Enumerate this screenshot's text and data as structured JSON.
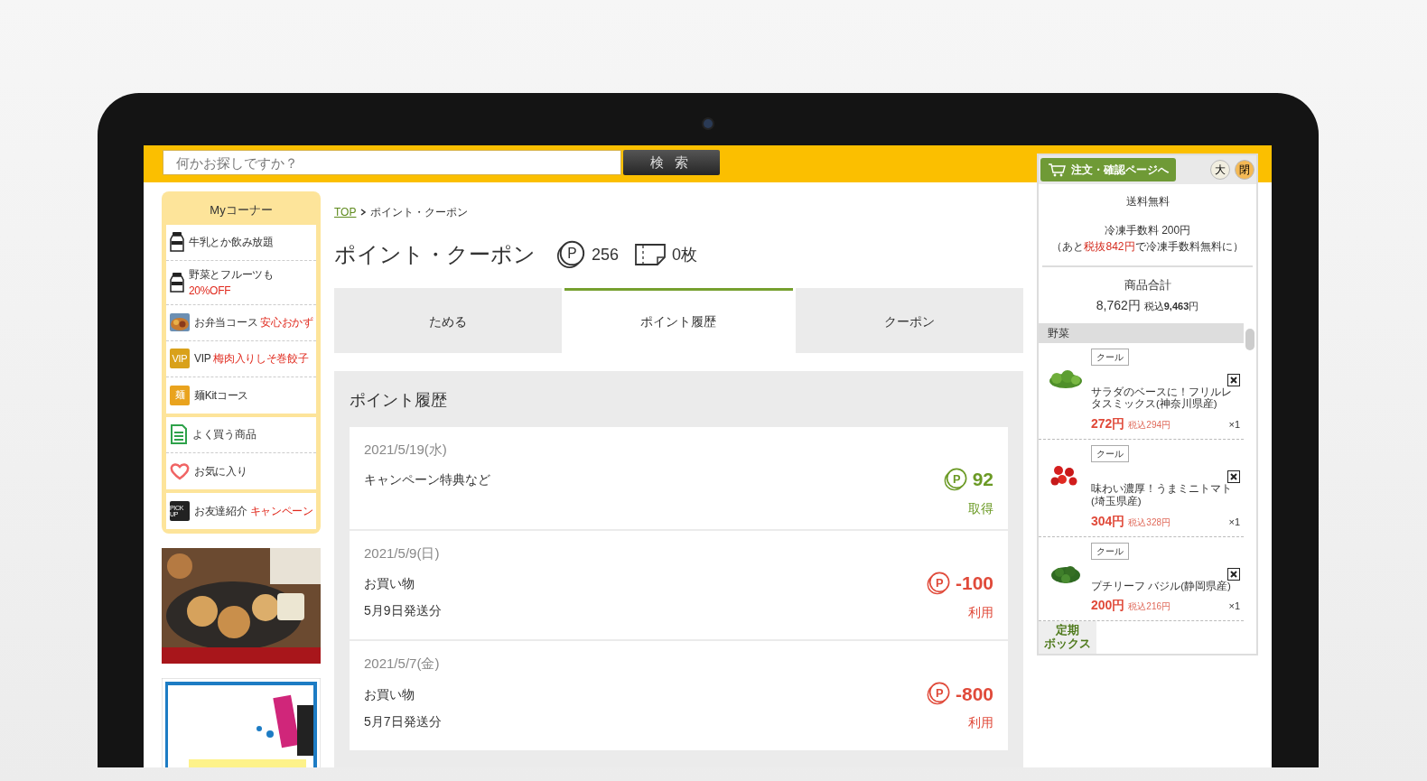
{
  "search": {
    "placeholder": "何かお探しですか？",
    "button": "検索"
  },
  "sidebar": {
    "title": "Myコーナー",
    "groups": [
      [
        {
          "kind": "milk",
          "label": "牛乳とか飲み放題"
        },
        {
          "kind": "milk",
          "label": "野菜とフルーツも",
          "note": "20%OFF",
          "note_below": true
        },
        {
          "kind": "bento",
          "label": "お弁当コース",
          "note": "安心おかず"
        },
        {
          "kind": "vip",
          "badge": "VIP",
          "label": "VIP",
          "note": "梅肉入りしそ巻餃子"
        },
        {
          "kind": "noodle",
          "badge": "麺",
          "label": "麺Kitコース"
        }
      ],
      [
        {
          "kind": "list",
          "label": "よく買う商品"
        },
        {
          "kind": "heart",
          "label": "お気に入り"
        }
      ],
      [
        {
          "kind": "pickup",
          "badge": "PICK UP",
          "label": "お友達紹介",
          "note": "キャンペーン"
        }
      ]
    ]
  },
  "breadcrumb": [
    {
      "label": "TOP",
      "link": true
    },
    {
      "label": "ポイント・クーポン",
      "link": false
    }
  ],
  "title": "ポイント・クーポン",
  "points": {
    "icon_letter": "P",
    "value": "256"
  },
  "coupons": {
    "value": "0枚"
  },
  "tabs": [
    {
      "label": "ためる",
      "selected": false
    },
    {
      "label": "ポイント履歴",
      "selected": true
    },
    {
      "label": "クーポン",
      "selected": false
    }
  ],
  "history": {
    "title": "ポイント履歴",
    "entries": [
      {
        "date": "2021/5/19(水)",
        "lines": [
          "キャンペーン特典など"
        ],
        "icon_letter": "P",
        "amount": "92",
        "label": "取得",
        "color": "#6b9a25"
      },
      {
        "date": "2021/5/9(日)",
        "lines": [
          "お買い物",
          "5月9日発送分"
        ],
        "icon_letter": "P",
        "amount": "-100",
        "label": "利用",
        "color": "#e04a3a"
      },
      {
        "date": "2021/5/7(金)",
        "lines": [
          "お買い物",
          "5月7日発送分"
        ],
        "icon_letter": "P",
        "amount": "-800",
        "label": "利用",
        "color": "#e04a3a"
      }
    ]
  },
  "cart": {
    "order_button": "注文・確認ページへ",
    "size_button": "大",
    "close_button": "閉",
    "shipping": "送料無料",
    "freeze_fee": "冷凍手数料 200円",
    "freeze_note": {
      "before": "（あと",
      "highlight": "税抜842円",
      "after": "で冷凍手数料無料に）"
    },
    "total_label": "商品合計",
    "total": "8,762円",
    "total_tax": "税込**9,463**円",
    "category": "野菜",
    "items": [
      {
        "tag": "クール",
        "name": "サラダのベースに！フリルレタスミックス(神奈川県産)",
        "price": "272円",
        "tax": "税込294円",
        "qty": "×1"
      },
      {
        "tag": "クール",
        "name": "味わい濃厚！うまミニトマト(埼玉県産)",
        "price": "304円",
        "tax": "税込328円",
        "qty": "×1"
      },
      {
        "tag": "クール",
        "name": "プチリーフ バジル(静岡県産)",
        "price": "200円",
        "tax": "税込216円",
        "qty": "×1"
      }
    ],
    "box_tab": [
      "定期",
      "ボックス"
    ]
  }
}
